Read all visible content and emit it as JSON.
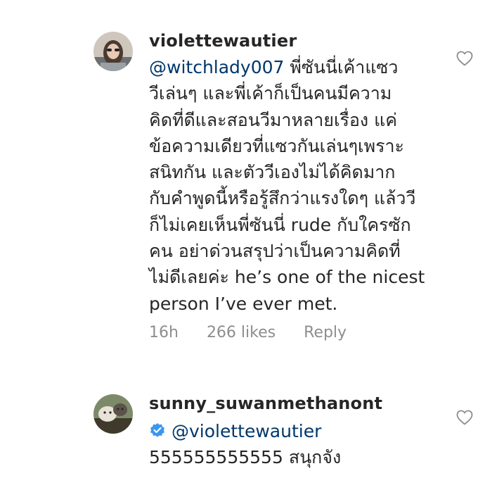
{
  "comments": [
    {
      "username": "violettewautier",
      "mention": "@witchlady007",
      "text_after_mention": " พี่ซันนี่เค้าแซว\nวีเล่นๆ และพี่เค้าก็เป็นคนมีความ\nคิดที่ดีและสอนวีมาหลายเรื่อง แค่\nข้อความเดียวที่แซวกันเล่นๆเพราะ\nสนิทกัน และตัววีเองไม่ได้คิดมาก\nกับคำพูดนี้หรือรู้สึกว่าแรงใดๆ แล้ววี\nก็ไม่เคยเห็นพี่ซันนี่ rude กับใครซัก\nคน อย่าด่วนสรุปว่าเป็นความคิดที่\nไม่ดีเลยค่ะ he’s one of the nicest\nperson I’ve ever met.",
      "time": "16h",
      "likes": "266 likes",
      "reply": "Reply"
    },
    {
      "username": "sunny_suwanmethanont",
      "mention": "@violettewautier",
      "text": "555555555555 สนุกจัง"
    }
  ],
  "icons": {
    "like": "heart-outline-icon",
    "verified": "verified-badge-icon"
  },
  "colors": {
    "mention": "#00376b",
    "meta": "#8e8e8e",
    "verified": "#3897f0"
  }
}
